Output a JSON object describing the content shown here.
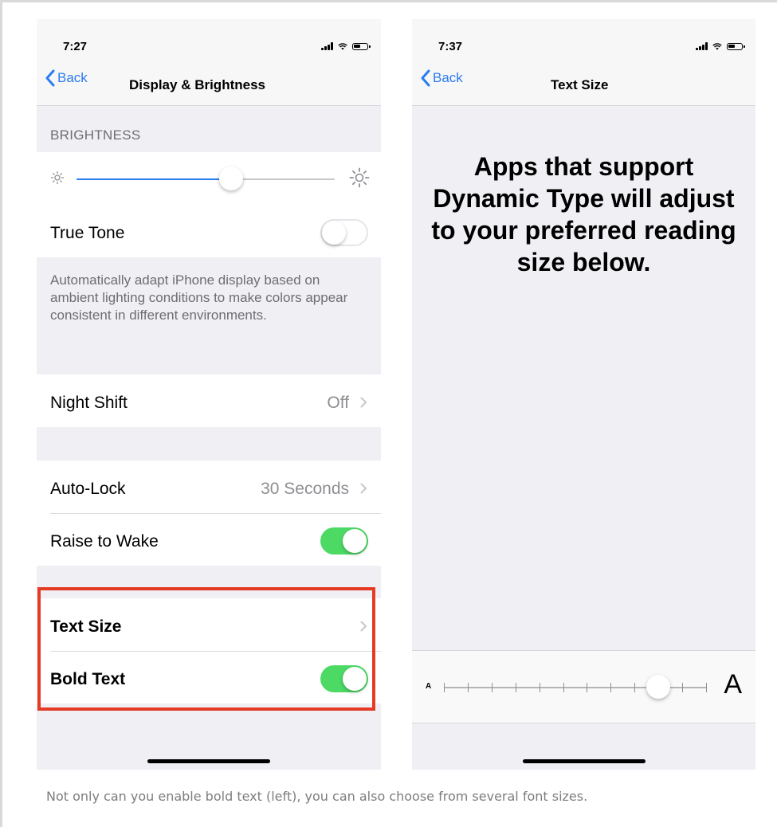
{
  "colors": {
    "accent": "#2a7cf0",
    "toggle_on": "#4cd964",
    "highlight": "#e53a24",
    "secondary_text": "#6d6d72",
    "value_text": "#8e8e93"
  },
  "left_phone": {
    "status_bar": {
      "time": "7:27",
      "icons": [
        "signal-icon",
        "wifi-icon",
        "battery-icon"
      ]
    },
    "navbar": {
      "back_label": "Back",
      "back_icon": "chevron-left-icon",
      "title": "Display & Brightness"
    },
    "brightness": {
      "section_header": "BRIGHTNESS",
      "slider_level": 0.6,
      "icons": [
        "sun-small-icon",
        "sun-large-icon"
      ]
    },
    "true_tone": {
      "label": "True Tone",
      "toggle_on": false,
      "footer": "Automatically adapt iPhone display based on ambient lighting conditions to make colors appear consistent in different environments."
    },
    "night_shift": {
      "label": "Night Shift",
      "value": "Off"
    },
    "auto_lock": {
      "label": "Auto-Lock",
      "value": "30 Seconds"
    },
    "raise_to_wake": {
      "label": "Raise to Wake",
      "toggle_on": true
    },
    "text_size": {
      "label": "Text Size"
    },
    "bold_text": {
      "label": "Bold Text",
      "toggle_on": true
    }
  },
  "right_phone": {
    "status_bar": {
      "time": "7:37",
      "icons": [
        "signal-icon",
        "wifi-icon",
        "battery-icon"
      ]
    },
    "navbar": {
      "back_label": "Back",
      "back_icon": "chevron-left-icon",
      "title": "Text Size"
    },
    "preview_text": "Apps that support Dynamic Type will adjust to your preferred reading size below.",
    "size_slider": {
      "small_label": "A",
      "large_label": "A",
      "steps": 12,
      "selected_index": 9
    }
  },
  "caption": "Not only can you enable bold text (left), you can also choose from several font sizes."
}
